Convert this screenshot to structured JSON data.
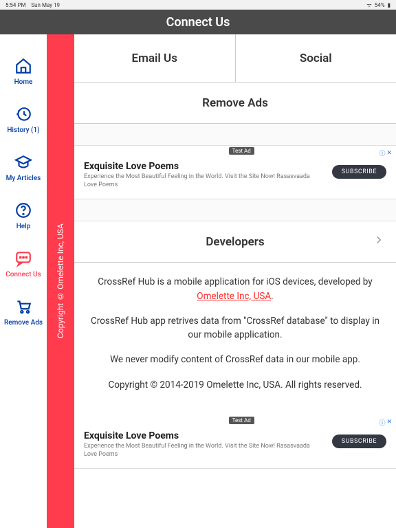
{
  "status": {
    "time": "5:54 PM",
    "date": "Sun May 19",
    "battery": "54%"
  },
  "header": {
    "title": "Connect Us"
  },
  "sidebar": {
    "copyright_strip": "Copyright © Omelette Inc, USA",
    "items": [
      {
        "label": "Home"
      },
      {
        "label": "History (1)"
      },
      {
        "label": "My Articles"
      },
      {
        "label": "Help"
      },
      {
        "label": "Connect Us"
      },
      {
        "label": "Remove Ads"
      }
    ]
  },
  "tabs": {
    "email": "Email Us",
    "social": "Social"
  },
  "sections": {
    "remove_ads": "Remove Ads",
    "developers": "Developers"
  },
  "ad": {
    "badge": "Test Ad",
    "title": "Exquisite Love Poems",
    "desc": "Experience the Most Beautiful Feeling in the World. Visit the Site Now! Rasasvaada Love Poems",
    "button": "SUBSCRIBE"
  },
  "info": {
    "p1a": "CrossRef Hub is a mobile application for iOS devices, developed by ",
    "p1b": "Omelette Inc, USA",
    "p2": "CrossRef Hub app retrives data from \"CrossRef database\" to display in our mobile application.",
    "p3": "We never modify content of CrossRef data in our mobile app.",
    "p4": "Copyright © 2014-2019 Omelette Inc, USA. All rights reserved."
  }
}
